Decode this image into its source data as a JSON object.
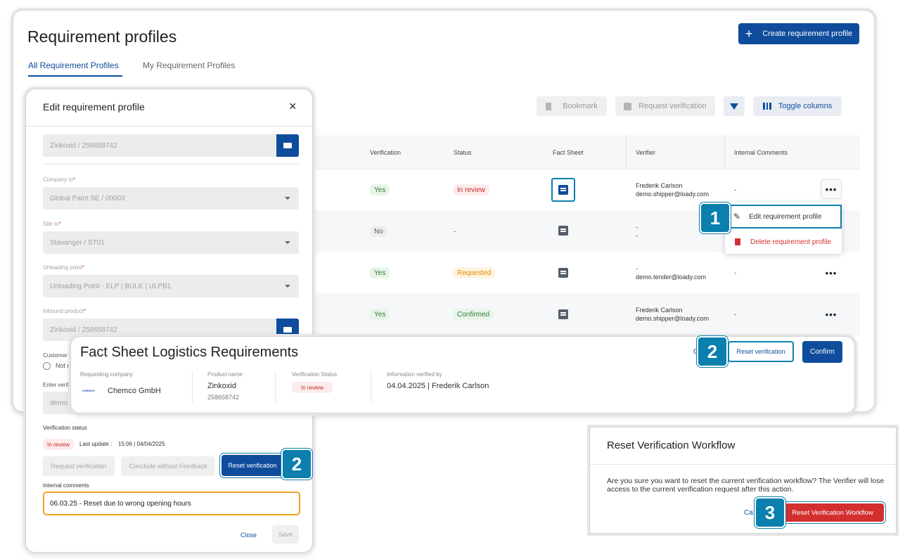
{
  "page": {
    "title": "Requirement profiles",
    "create_button": "Create requirement profile",
    "tabs": [
      "All Requirement Profiles",
      "My Requirement Profiles"
    ],
    "toolbar": {
      "bookmark": "Bookmark",
      "request_verification": "Request verification",
      "toggle_columns": "Toggle columns"
    },
    "columns": [
      "Verification",
      "Status",
      "Fact Sheet",
      "Verifier",
      "Internal Comments"
    ],
    "rows": [
      {
        "verification": "Yes",
        "status": "In review",
        "verifier_name": "Frederik Carlson",
        "verifier_email": "demo.shipper@loady.com",
        "comment": "-"
      },
      {
        "verification": "No",
        "status": "-",
        "verifier_name": "-",
        "verifier_email": "-",
        "comment": ""
      },
      {
        "verification": "Yes",
        "status": "Requested",
        "verifier_name": "-",
        "verifier_email": "demo.tender@loady.com",
        "comment": "-"
      },
      {
        "verification": "Yes",
        "status": "Confirmed",
        "verifier_name": "Frederik Carlson",
        "verifier_email": "demo.shipper@loady.com",
        "comment": "-"
      }
    ],
    "context_menu": {
      "edit": "Edit requirement profile",
      "delete": "Delete requirement profile"
    }
  },
  "edit_modal": {
    "title": "Edit requirement profile",
    "top_product": "Zinkoxid / 258658742",
    "company_label": "Company to",
    "company_value": "Global Paint SE / 00003",
    "site_label": "Site to",
    "site_value": "Stavanger / ST01",
    "unloading_label": "Unloading point",
    "unloading_value": "Unloading Point - ELP | BULK | ULPB1",
    "inbound_label": "Inbound product",
    "inbound_value": "Zinkoxid / 258658742",
    "customer_label": "Customer V",
    "radio_label": "Not r",
    "enter_label": "Enter verifi",
    "enter_value": "demo",
    "verification_status_label": "Verification status",
    "status_badge": "In review",
    "last_update_label": "Last update :",
    "last_update_value": "15:06 | 04/04/2025",
    "request_btn": "Request verification",
    "conclude_btn": "Conclude without Feedback",
    "reset_btn": "Reset verification",
    "comments_label": "Internal comments",
    "comments_value": "06.03.25 - Reset due to wrong opening hours",
    "close_btn": "Close",
    "save_btn": "Save"
  },
  "fact_sheet": {
    "title": "Fact Sheet Logistics Requirements",
    "cancel_partial": "C",
    "reset_btn": "Reset verification",
    "confirm_btn": "Confirm",
    "requesting_company_label": "Requesting company",
    "company_logo": "CHEMCO",
    "company_name": "Chemco GmbH",
    "product_label": "Product name",
    "product_name": "Zinkoxid",
    "product_id": "258658742",
    "verification_status_label": "Verification Status",
    "verification_status": "In review",
    "verified_by_label": "Information verified by",
    "verified_by": "04.04.2025 | Frederik Carlson"
  },
  "reset_dialog": {
    "title": "Reset Verification Workflow",
    "message": "Are you sure you want to reset the current verification workflow? The Verifier will lose access to the current verification request after this action.",
    "cancel_partial": "Ca",
    "confirm_btn": "Reset Verification Workflow"
  },
  "callouts": [
    "1",
    "2",
    "2",
    "3"
  ],
  "colors": {
    "primary": "#0f4c9c",
    "callout": "#0b7fae",
    "danger": "#d32f2f",
    "highlight": "#f0a020"
  }
}
